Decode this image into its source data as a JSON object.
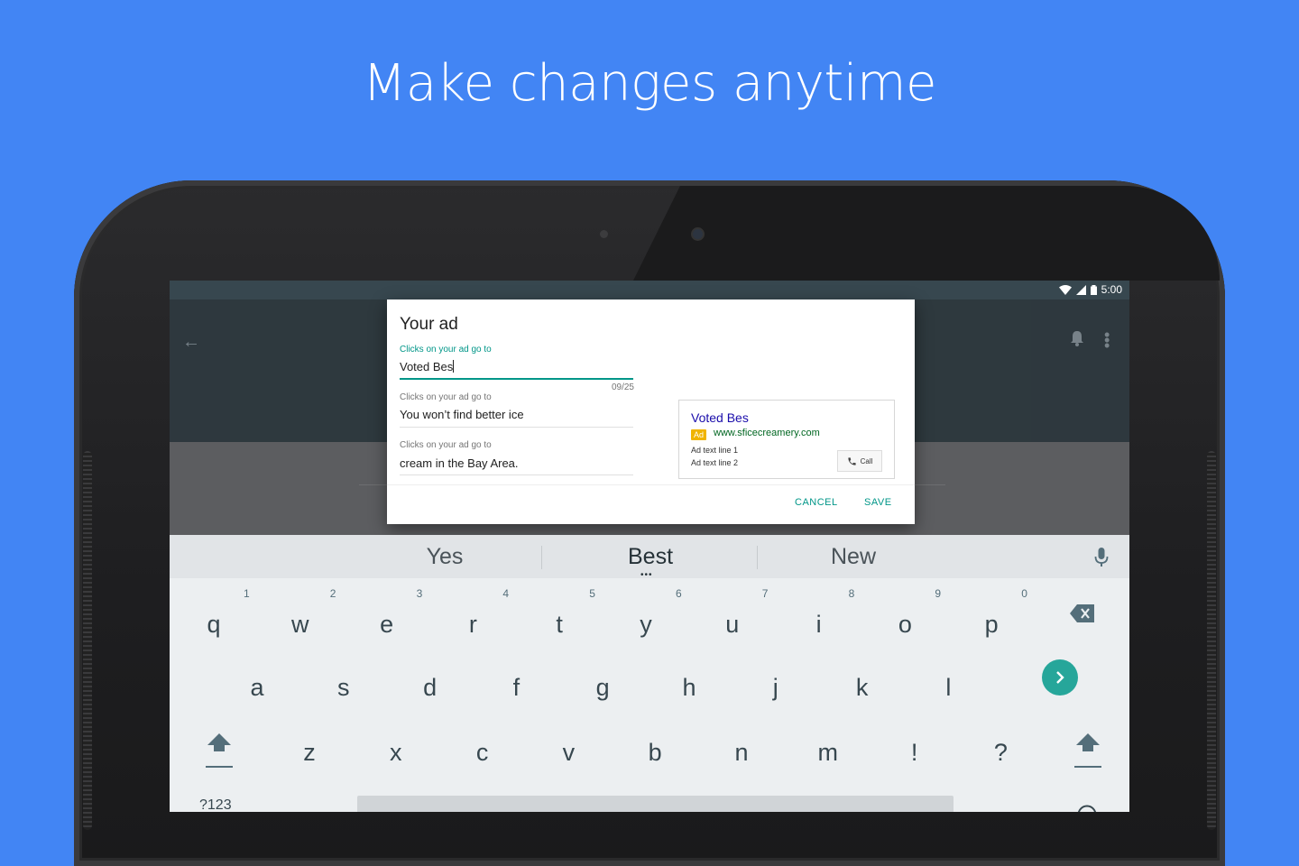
{
  "headline": "Make changes anytime",
  "status": {
    "time": "5:00"
  },
  "dialog": {
    "title": "Your ad",
    "fields": [
      {
        "label": "Clicks on your ad go to",
        "value": "Voted Bes",
        "counter": "09/25"
      },
      {
        "label": "Clicks on your ad go to",
        "value": "You won’t find better ice"
      },
      {
        "label": "Clicks on your ad go to",
        "value": "cream in the Bay Area."
      }
    ],
    "preview": {
      "title": "Voted Bes",
      "badge": "Ad",
      "url": "www.sficecreamery.com",
      "line1": "Ad text line 1",
      "line2": "Ad text line 2",
      "call_label": "Call"
    },
    "cancel_label": "CANCEL",
    "save_label": "SAVE"
  },
  "keyboard": {
    "suggestions": [
      "Yes",
      "Best",
      "New"
    ],
    "row1": [
      "q",
      "w",
      "e",
      "r",
      "t",
      "y",
      "u",
      "i",
      "o",
      "p"
    ],
    "row1_hints": [
      "1",
      "2",
      "3",
      "4",
      "5",
      "6",
      "7",
      "8",
      "9",
      "0"
    ],
    "row2": [
      "a",
      "s",
      "d",
      "f",
      "g",
      "h",
      "j",
      "k",
      "l"
    ],
    "row3": [
      "z",
      "x",
      "c",
      "v",
      "b",
      "n",
      "m",
      "!",
      "?"
    ],
    "symbols_label": "?123"
  },
  "colors": {
    "background": "#4285f4",
    "accent": "#009688",
    "enter": "#26a69a"
  }
}
